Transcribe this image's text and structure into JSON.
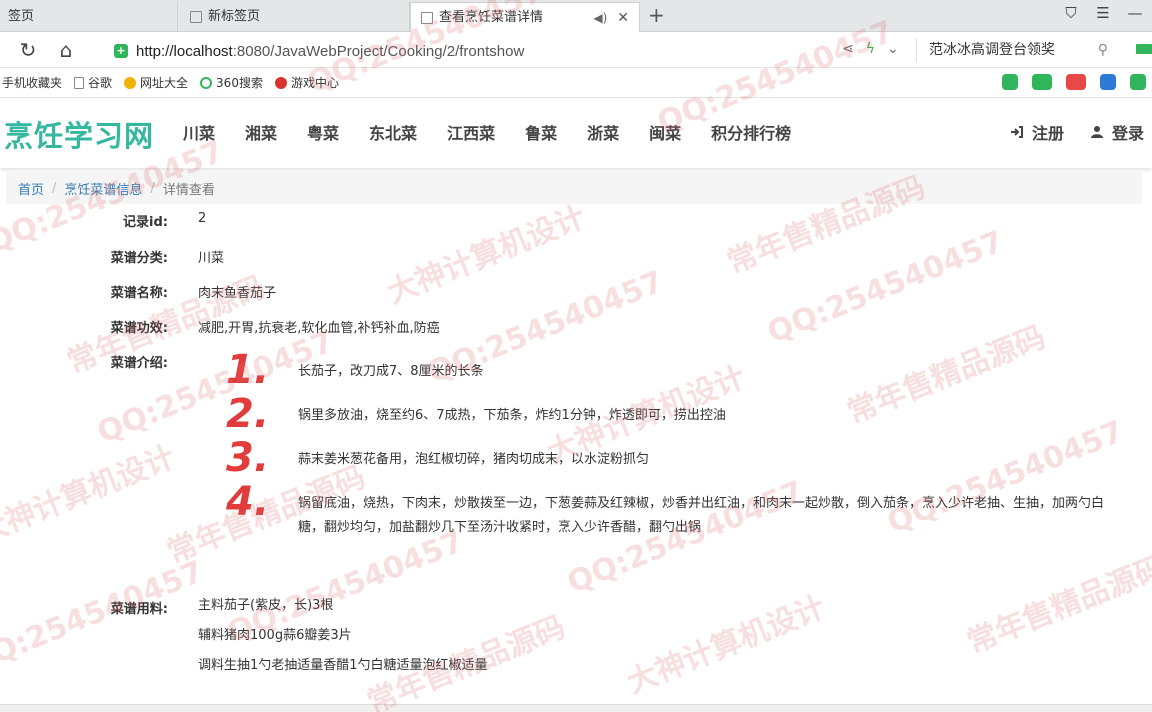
{
  "browser": {
    "tabs": [
      {
        "label": "签页"
      },
      {
        "label": "新标签页"
      },
      {
        "label": "查看烹饪菜谱详情"
      }
    ],
    "url_host": "http://localhost",
    "url_rest": ":8080/JavaWebProject/Cooking/2/frontshow",
    "search_text": "范冰冰高调登台领奖",
    "bookmarks": [
      "手机收藏夹",
      "谷歌",
      "网址大全",
      "360搜索",
      "游戏中心"
    ]
  },
  "site": {
    "logo": "烹饪学习网",
    "nav": [
      "川菜",
      "湘菜",
      "粤菜",
      "东北菜",
      "江西菜",
      "鲁菜",
      "浙菜",
      "闽菜",
      "积分排行榜"
    ],
    "register": "注册",
    "login": "登录"
  },
  "breadcrumb": {
    "home": "首页",
    "section": "烹饪菜谱信息",
    "current": "详情查看"
  },
  "detail": {
    "id_label": "记录id:",
    "id_value": "2",
    "category_label": "菜谱分类:",
    "category_value": "川菜",
    "name_label": "菜谱名称:",
    "name_value": "肉末鱼香茄子",
    "effect_label": "菜谱功效:",
    "effect_value": "减肥,开胃,抗衰老,软化血管,补钙补血,防癌",
    "intro_label": "菜谱介绍:",
    "steps": [
      {
        "num": "1.",
        "text": "长茄子，改刀成7、8厘米的长条"
      },
      {
        "num": "2.",
        "text": "锅里多放油，烧至约6、7成热，下茄条，炸约1分钟，炸透即可，捞出控油"
      },
      {
        "num": "3.",
        "text": "蒜末姜米葱花备用，泡红椒切碎，猪肉切成末，以水淀粉抓匀"
      },
      {
        "num": "4.",
        "text": "锅留底油，烧热，下肉末，炒散拨至一边，下葱姜蒜及红辣椒，炒香并出红油，和肉末一起炒散，倒入茄条，烹入少许老抽、生抽，加两勺白糖，翻炒均匀，加盐翻炒几下至汤汁收紧时，烹入少许香醋，翻勺出锅"
      }
    ],
    "ingredients_label": "菜谱用料:",
    "ingredients": [
      "主料茄子(紫皮，长)3根",
      "辅料猪肉100g蒜6瓣姜3片",
      "调料生抽1勺老抽适量香醋1勺白糖适量泡红椒适量"
    ]
  },
  "watermarks": [
    "QQ:254540457",
    "常年售精品源码",
    "大神计算机设计"
  ]
}
